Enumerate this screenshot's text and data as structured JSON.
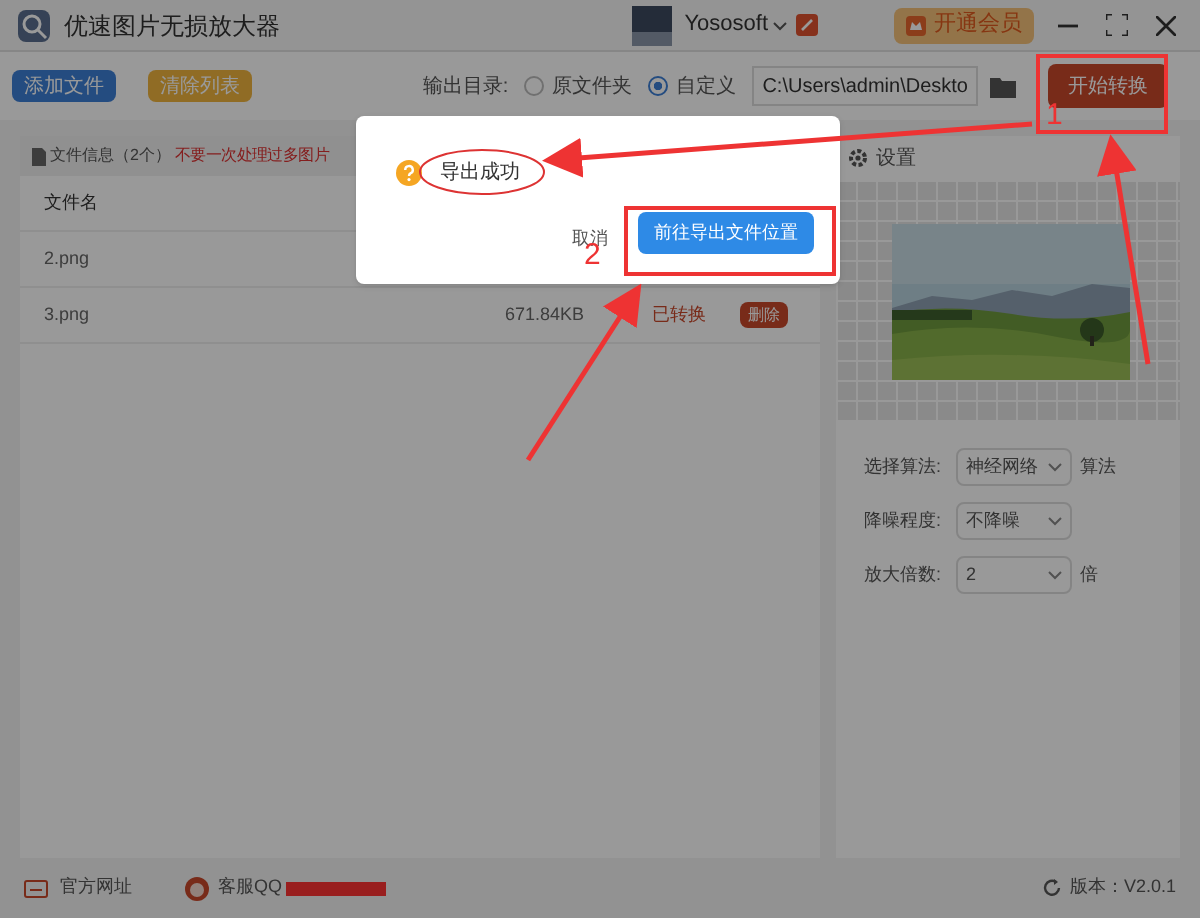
{
  "window": {
    "title": "优速图片无损放大器",
    "user": "Yososoft",
    "vip_button": "开通会员"
  },
  "toolbar": {
    "add_button": "添加文件",
    "clear_button": "清除列表",
    "output_label": "输出目录:",
    "radios": [
      {
        "label": "原文件夹",
        "selected": false
      },
      {
        "label": "自定义",
        "selected": true
      }
    ],
    "path": "C:\\Users\\admin\\Deskto",
    "start_button": "开始转换"
  },
  "file_panel": {
    "title": "文件信息（2个）",
    "warning": "不要一次处理过多图片",
    "columns": [
      "文件名"
    ],
    "rows": [
      {
        "name": "2.png"
      },
      {
        "name": "3.png",
        "size": "671.84KB",
        "status": "已转换",
        "action": "删除"
      }
    ]
  },
  "settings": {
    "title": "设置",
    "fields": [
      {
        "label": "选择算法:",
        "value": "神经网络",
        "suffix": "算法"
      },
      {
        "label": "降噪程度:",
        "value": "不降噪"
      },
      {
        "label": "放大倍数:",
        "value": "2",
        "suffix": "倍"
      }
    ]
  },
  "dialog": {
    "message": "导出成功",
    "cancel": "取消",
    "confirm": "前往导出文件位置"
  },
  "footer": {
    "website": "官方网址",
    "support": "客服QQ",
    "version": "版本：V2.0.1"
  },
  "annotations": [
    {
      "label": "1"
    },
    {
      "label": "2"
    }
  ]
}
